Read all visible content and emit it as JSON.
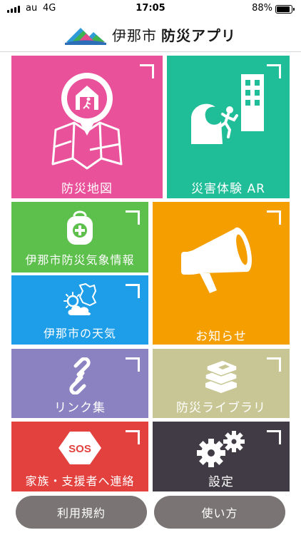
{
  "status_bar": {
    "carrier": "au",
    "network": "4G",
    "time": "17:05",
    "battery_percent": "88%",
    "battery_level": 0.88
  },
  "header": {
    "city": "伊那市",
    "app_name": "防災アプリ",
    "logo_icon": "mountains-logo-icon"
  },
  "tiles": {
    "map": {
      "label": "防災地図",
      "color": "#e9519a",
      "icon": "evacuation-map-icon"
    },
    "ar": {
      "label": "災害体験 AR",
      "color": "#1fbd98",
      "icon": "tsunami-escape-icon"
    },
    "weather_info": {
      "label": "伊那市防災気象情報",
      "color": "#5dbf4c",
      "icon": "emergency-bag-icon"
    },
    "notice": {
      "label": "お知らせ",
      "color": "#f49e00",
      "icon": "megaphone-icon"
    },
    "weather": {
      "label": "伊那市の天気",
      "color": "#1e9ee8",
      "icon": "weather-icon"
    },
    "links": {
      "label": "リンク集",
      "color": "#8b82c2",
      "icon": "link-icon"
    },
    "library": {
      "label": "防災ライブラリ",
      "color": "#c7c694",
      "icon": "books-icon"
    },
    "contact": {
      "label": "家族・支援者へ連絡",
      "color": "#e2413e",
      "icon": "sos-icon",
      "sos_text": "SOS"
    },
    "settings": {
      "label": "設定",
      "color": "#403b44",
      "icon": "gear-icon"
    }
  },
  "buttons": {
    "terms": "利用規約",
    "howto": "使い方"
  }
}
